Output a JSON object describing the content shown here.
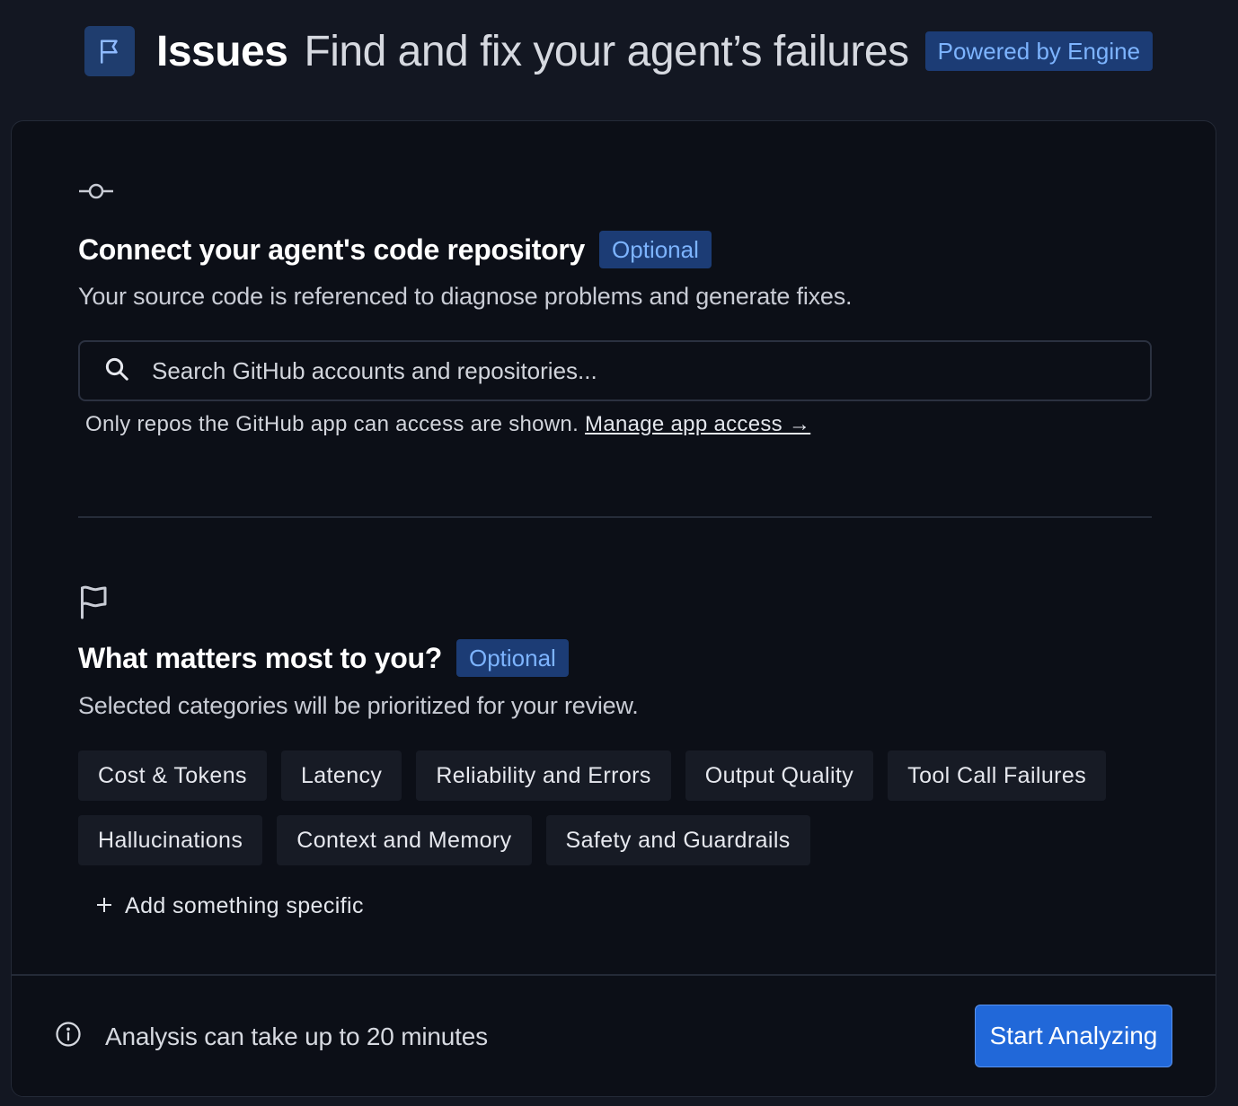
{
  "header": {
    "title": "Issues",
    "subtitle": "Find and fix your agent’s failures",
    "badge": "Powered by Engine"
  },
  "repo_section": {
    "title": "Connect your agent's code repository",
    "badge": "Optional",
    "description": "Your source code is referenced to diagnose problems and generate fixes.",
    "search_placeholder": "Search GitHub accounts and repositories...",
    "note": "Only repos the GitHub app can access are shown.",
    "link": "Manage app access →"
  },
  "priorities_section": {
    "title": "What matters most to you?",
    "badge": "Optional",
    "description": "Selected categories will be prioritized for your review.",
    "categories_row1": [
      "Cost & Tokens",
      "Latency",
      "Reliability and Errors",
      "Output Quality",
      "Tool Call Failures"
    ],
    "categories_row2": [
      "Hallucinations",
      "Context and Memory",
      "Safety and Guardrails"
    ],
    "add_label": "Add something specific"
  },
  "footer": {
    "info": "Analysis can take up to 20 minutes",
    "button": "Start Analyzing"
  },
  "colors": {
    "accent": "#2168d9",
    "badge_bg": "#1c3c75",
    "badge_text": "#7db4ff",
    "background": "#131722",
    "card": "#0c0f17"
  },
  "icons": {
    "header": "flag-icon",
    "repo": "git-commit-icon",
    "priorities": "flag-icon",
    "search": "search-icon",
    "add": "plus-icon",
    "info": "info-icon"
  }
}
